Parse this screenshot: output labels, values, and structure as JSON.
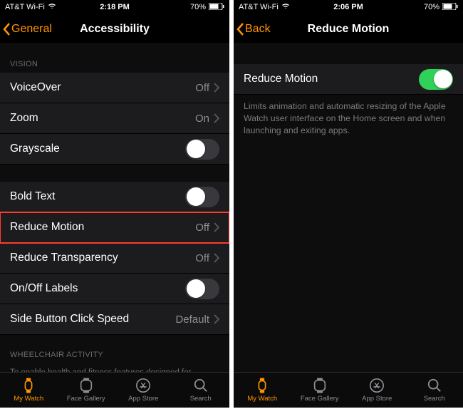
{
  "left": {
    "status": {
      "carrier": "AT&T Wi-Fi",
      "time": "2:18 PM",
      "battery": "70%"
    },
    "nav": {
      "back": "General",
      "title": "Accessibility"
    },
    "group1_header": "VISION",
    "rows": {
      "voiceover": {
        "label": "VoiceOver",
        "value": "Off"
      },
      "zoom": {
        "label": "Zoom",
        "value": "On"
      },
      "grayscale": {
        "label": "Grayscale"
      },
      "boldtext": {
        "label": "Bold Text"
      },
      "reducemotion": {
        "label": "Reduce Motion",
        "value": "Off"
      },
      "reducetransparency": {
        "label": "Reduce Transparency",
        "value": "Off"
      },
      "onofflabels": {
        "label": "On/Off Labels"
      },
      "sidebutton": {
        "label": "Side Button Click Speed",
        "value": "Default"
      }
    },
    "group2_header": "WHEELCHAIR ACTIVITY",
    "group2_footer": "To enable health and fitness features designed for wheelchair activity, edit the wheelchair preference in the Health section of My Watch."
  },
  "right": {
    "status": {
      "carrier": "AT&T Wi-Fi",
      "time": "2:06 PM",
      "battery": "70%"
    },
    "nav": {
      "back": "Back",
      "title": "Reduce Motion"
    },
    "row": {
      "label": "Reduce Motion"
    },
    "desc": "Limits animation and automatic resizing of the Apple Watch user interface on the Home screen and when launching and exiting apps."
  },
  "tabs": {
    "mywatch": "My Watch",
    "facegallery": "Face Gallery",
    "appstore": "App Store",
    "search": "Search"
  }
}
